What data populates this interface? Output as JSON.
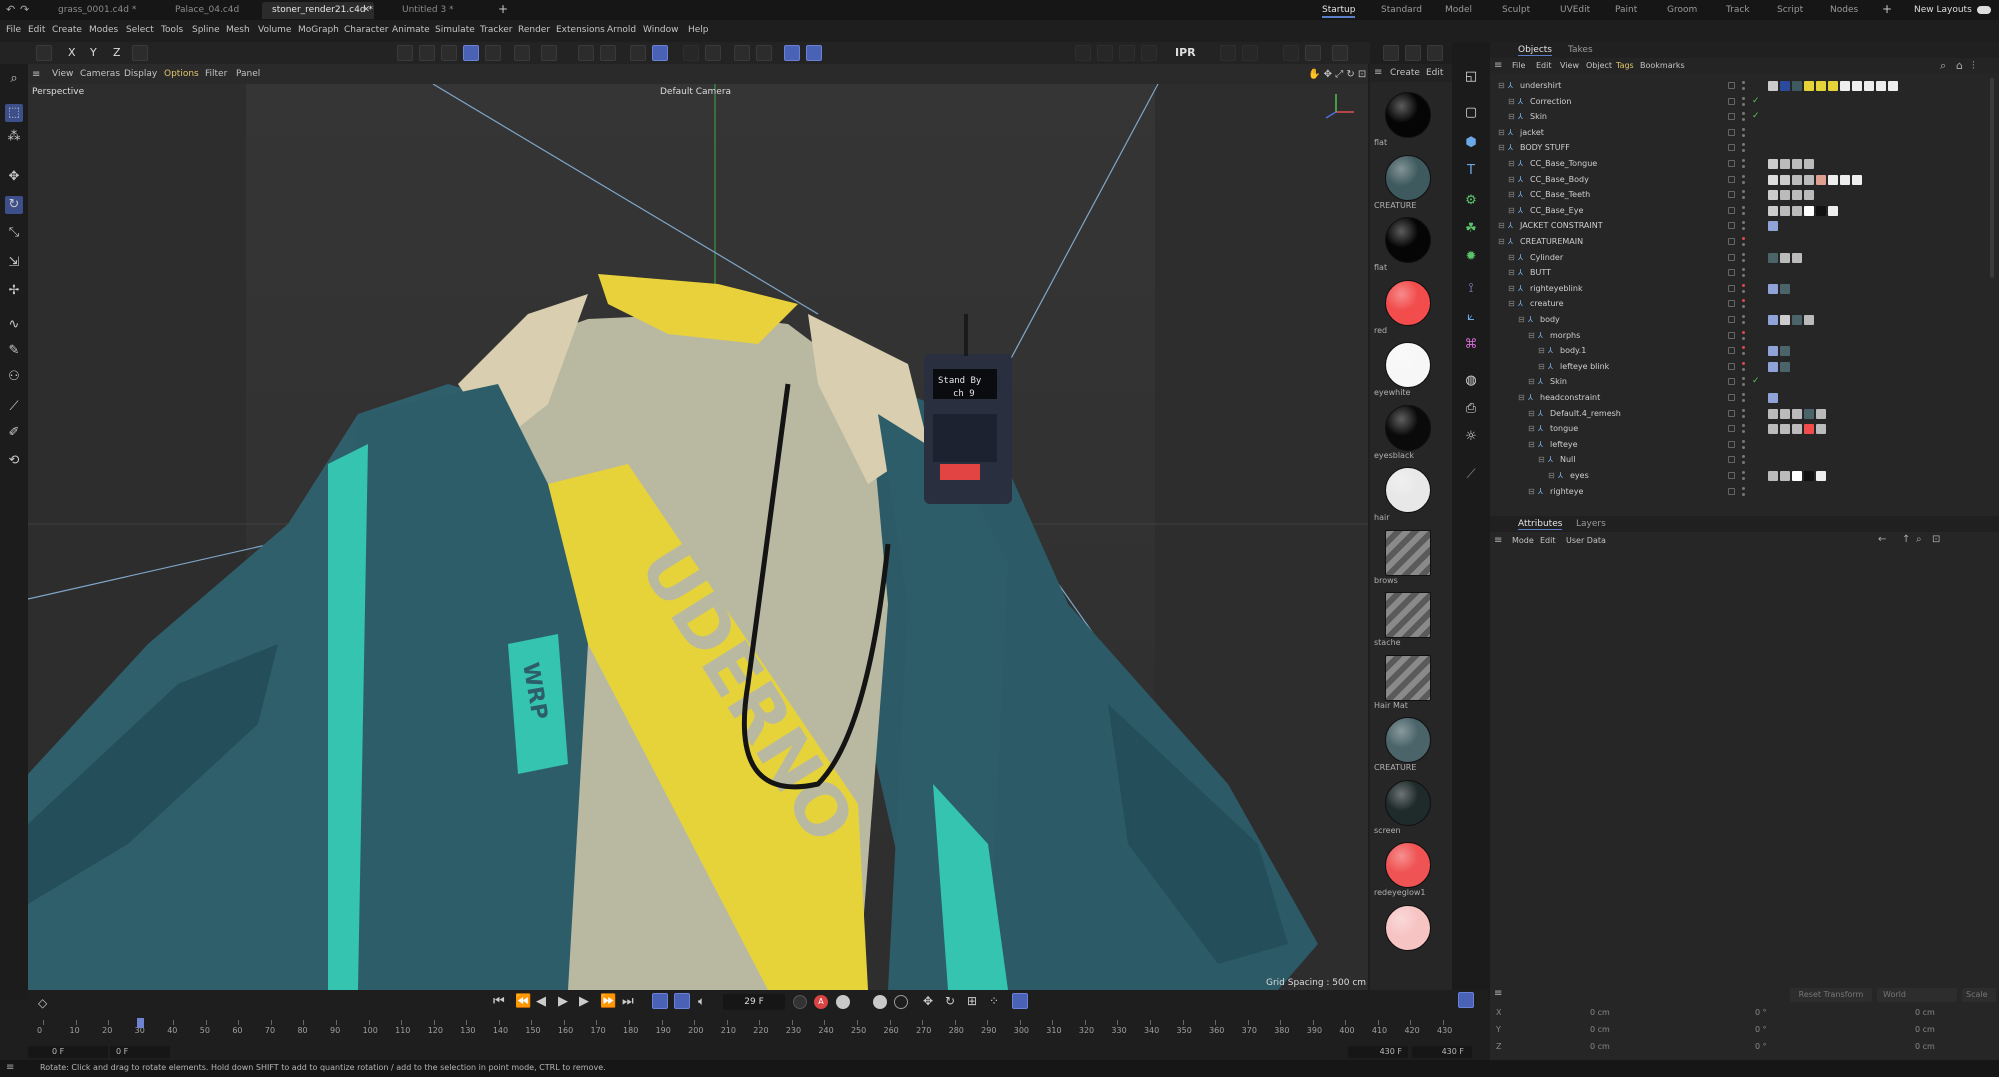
{
  "doc_tabs": [
    {
      "label": "grass_0001.c4d *"
    },
    {
      "label": "Palace_04.c4d"
    },
    {
      "label": "stoner_render21.c4d *"
    },
    {
      "label": "Untitled 3 *"
    }
  ],
  "layout_tabs": [
    "Startup",
    "Standard",
    "Model",
    "Sculpt",
    "UVEdit",
    "Paint",
    "Groom",
    "Track",
    "Script",
    "Nodes"
  ],
  "new_layouts": "New Layouts",
  "menu": [
    "File",
    "Edit",
    "Create",
    "Modes",
    "Select",
    "Tools",
    "Spline",
    "Mesh",
    "Volume",
    "MoGraph",
    "Character",
    "Animate",
    "Simulate",
    "Tracker",
    "Render",
    "Extensions",
    "Arnold",
    "Window",
    "Help"
  ],
  "toolbar": {
    "axis_x": "X",
    "axis_y": "Y",
    "axis_z": "Z",
    "ipr": "IPR"
  },
  "viewport": {
    "menu": [
      "View",
      "Cameras",
      "Display",
      "Options",
      "Filter",
      "Panel"
    ],
    "label": "Perspective",
    "camera": "Default Camera",
    "grid_spacing": "Grid Spacing : 500 cm",
    "shirt_text": "UDERNO",
    "badge_text": "WRP",
    "radio_line1": "Stand By",
    "radio_line2": "ch 9"
  },
  "materials_panel": {
    "menu": [
      "Create",
      "Edit"
    ],
    "items": [
      {
        "label": "flat",
        "color": "#050505"
      },
      {
        "label": "CREATURE",
        "color": "#3f5a5e"
      },
      {
        "label": "flat",
        "color": "#050505"
      },
      {
        "label": "red",
        "color": "#f24c4c"
      },
      {
        "label": "eyewhite",
        "color": "#f7f7f7"
      },
      {
        "label": "eyesblack",
        "color": "#0a0a0a"
      },
      {
        "label": "hair",
        "color": "#e8e8e8"
      },
      {
        "label": "brows",
        "color": "stripe"
      },
      {
        "label": "stache",
        "color": "stripe"
      },
      {
        "label": "Hair Mat",
        "color": "stripe"
      },
      {
        "label": "CREATURE",
        "color": "#4a6469"
      },
      {
        "label": "screen",
        "color": "#1f2a2b"
      },
      {
        "label": "redeyeglow1",
        "color": "#f05353"
      },
      {
        "label": "",
        "color": "#f7c4c4"
      }
    ]
  },
  "objects_panel": {
    "tabs": [
      "Objects",
      "Takes"
    ],
    "menu": [
      "File",
      "Edit",
      "View",
      "Object",
      "Tags",
      "Bookmarks"
    ],
    "rows": [
      {
        "name": "undershirt",
        "indent": 0,
        "check": ""
      },
      {
        "name": "Correction",
        "indent": 1,
        "check": "✓"
      },
      {
        "name": "Skin",
        "indent": 1,
        "check": "✓"
      },
      {
        "name": "jacket",
        "indent": 0,
        "check": ""
      },
      {
        "name": "BODY STUFF",
        "indent": 0,
        "check": ""
      },
      {
        "name": "CC_Base_Tongue",
        "indent": 1,
        "check": ""
      },
      {
        "name": "CC_Base_Body",
        "indent": 1,
        "check": ""
      },
      {
        "name": "CC_Base_Teeth",
        "indent": 1,
        "check": ""
      },
      {
        "name": "CC_Base_Eye",
        "indent": 1,
        "check": ""
      },
      {
        "name": "JACKET CONSTRAINT",
        "indent": 0,
        "check": ""
      },
      {
        "name": "CREATUREMAIN",
        "indent": 0,
        "check": ""
      },
      {
        "name": "Cylinder",
        "indent": 1,
        "check": ""
      },
      {
        "name": "BUTT",
        "indent": 1,
        "check": ""
      },
      {
        "name": "righteyeblink",
        "indent": 1,
        "check": ""
      },
      {
        "name": "creature",
        "indent": 1,
        "check": ""
      },
      {
        "name": "body",
        "indent": 2,
        "check": ""
      },
      {
        "name": "morphs",
        "indent": 3,
        "check": ""
      },
      {
        "name": "body.1",
        "indent": 4,
        "check": ""
      },
      {
        "name": "lefteye blink",
        "indent": 4,
        "check": ""
      },
      {
        "name": "Skin",
        "indent": 3,
        "check": "✓"
      },
      {
        "name": "headconstraint",
        "indent": 2,
        "check": ""
      },
      {
        "name": "Default.4_remesh",
        "indent": 3,
        "check": ""
      },
      {
        "name": "tongue",
        "indent": 3,
        "check": ""
      },
      {
        "name": "lefteye",
        "indent": 3,
        "check": ""
      },
      {
        "name": "Null",
        "indent": 4,
        "check": ""
      },
      {
        "name": "eyes",
        "indent": 5,
        "check": ""
      },
      {
        "name": "righteye",
        "indent": 3,
        "check": ""
      }
    ]
  },
  "attributes_panel": {
    "tabs": [
      "Attributes",
      "Layers"
    ],
    "menu": [
      "Mode",
      "Edit",
      "User Data"
    ]
  },
  "coords": {
    "buttons": [
      "Reset Transform",
      "World",
      "Scale"
    ],
    "rows": [
      {
        "axis": "X",
        "pos": "0 cm",
        "rot": "0 °",
        "size": "0 cm"
      },
      {
        "axis": "Y",
        "pos": "0 cm",
        "rot": "0 °",
        "size": "0 cm"
      },
      {
        "axis": "Z",
        "pos": "0 cm",
        "rot": "0 °",
        "size": "0 cm"
      }
    ]
  },
  "timeline": {
    "current_frame": "29 F",
    "start_field": "0 F",
    "start_field2": "0 F",
    "end_field": "430 F",
    "end_field2": "430 F",
    "ticks": [
      "0",
      "10",
      "20",
      "30",
      "40",
      "50",
      "60",
      "70",
      "80",
      "90",
      "100",
      "110",
      "120",
      "130",
      "140",
      "150",
      "160",
      "170",
      "180",
      "190",
      "200",
      "210",
      "220",
      "230",
      "240",
      "250",
      "260",
      "270",
      "280",
      "290",
      "300",
      "310",
      "320",
      "330",
      "340",
      "350",
      "360",
      "370",
      "380",
      "390",
      "400",
      "410",
      "420",
      "430"
    ]
  },
  "status": "Rotate: Click and drag to rotate elements. Hold down SHIFT to add to quantize rotation / add to the selection in point mode, CTRL to remove."
}
